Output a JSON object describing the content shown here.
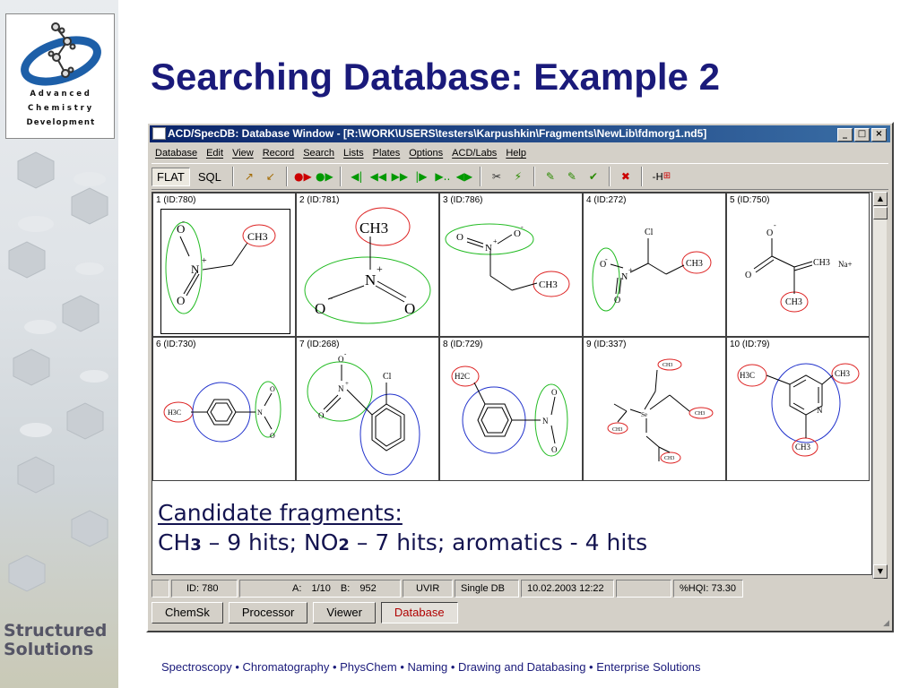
{
  "brand": {
    "logo_lines": [
      "Advanced",
      "Chemistry",
      "Development"
    ],
    "tagline": [
      "Structured",
      "Solutions"
    ]
  },
  "slide": {
    "title": "Searching Database: Example 2"
  },
  "window": {
    "title": "ACD/SpecDB: Database Window - [R:\\WORK\\USERS\\testers\\Karpushkin\\Fragments\\NewLib\\fdmorg1.nd5]",
    "controls": [
      "_",
      "□",
      "×"
    ],
    "menu": [
      "Database",
      "Edit",
      "View",
      "Record",
      "Search",
      "Lists",
      "Plates",
      "Options",
      "ACD/Labs",
      "Help"
    ],
    "toolbar": {
      "flat": "FLAT",
      "sql": "SQL",
      "h_label": "-H"
    },
    "records": [
      {
        "label": "1 (ID:780)"
      },
      {
        "label": "2 (ID:781)"
      },
      {
        "label": "3 (ID:786)"
      },
      {
        "label": "4 (ID:272)"
      },
      {
        "label": "5 (ID:750)"
      },
      {
        "label": "6 (ID:730)"
      },
      {
        "label": "7 (ID:268)"
      },
      {
        "label": "8 (ID:729)"
      },
      {
        "label": "9 (ID:337)"
      },
      {
        "label": "10 (ID:79)"
      }
    ],
    "chem_text": {
      "ch3": "CH3",
      "h3c": "H3C",
      "h2c": "H2C",
      "n": "N",
      "n_plus": "+",
      "o": "O",
      "minus": "-",
      "cl": "Cl",
      "na_plus": "Na+",
      "se": "Se"
    },
    "status": {
      "id": "ID: 780",
      "a": "A: 1/10",
      "b": "B: 952",
      "mode": "UVIR",
      "db": "Single DB",
      "date": "10.02.2003 12:22",
      "hqi": "%HQI: 73.30"
    },
    "tabs": [
      "ChemSk",
      "Processor",
      "Viewer",
      "Database"
    ],
    "active_tab": "Database"
  },
  "overlay": {
    "heading": "Candidate fragments:",
    "line_prefix": "CH",
    "line_sub1": "3",
    "line_mid": " – 9 hits; NO",
    "line_sub2": "2",
    "line_suffix": " – 7 hits; aromatics - 4 hits"
  },
  "footer": {
    "text": "Spectroscopy  • Chromatography • PhysChem • Naming • Drawing and Databasing • Enterprise Solutions"
  },
  "colors": {
    "title": "#1a1a7a",
    "window_title_bg": "#0a246a",
    "highlight_green": "#22bb22",
    "highlight_red": "#dd2222",
    "highlight_blue": "#2233cc"
  }
}
